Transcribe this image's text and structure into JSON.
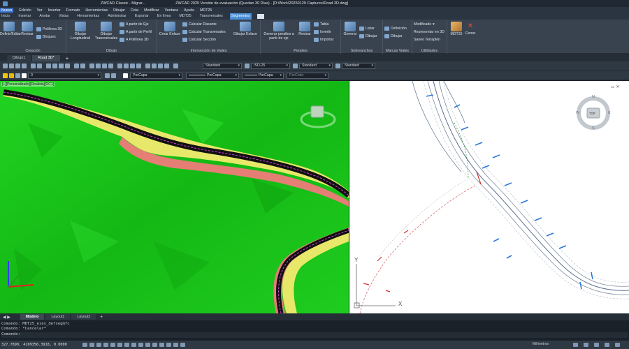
{
  "titlebar": {
    "quick_title": "ZWCAD Classic - Migrar...",
    "title": "ZWCAD 2025 Versión de evaluación (Quedan 30 Días) - [D:\\Work\\20250129 Captures\\Road 3D.dwg]"
  },
  "menu": [
    "Nuevo",
    "Edición",
    "Ver",
    "Insertar",
    "Formato",
    "Herramientas",
    "Dibujar",
    "Cota",
    "Modificar",
    "Ventana",
    "Ayuda",
    "MDT25"
  ],
  "ribbon_tabs": [
    "Inicio",
    "Insertar",
    "Anotar",
    "Vistas",
    "Herramientas",
    "Administrar",
    "Exportar",
    "En línea",
    "MDT25",
    "Transversales",
    "Segmentos"
  ],
  "ribbon_active_tab": "Segmentos",
  "ribbon": {
    "creacion": {
      "label": "Creación",
      "definir": "Definir/Editar",
      "revisar": "Revisar",
      "polilinea3d": "Polilínea 3D",
      "bloques": "Bloques"
    },
    "dibujo": {
      "label": "Dibujo",
      "longitudinal": "Dibujar Longitudinal",
      "transversales": "Dibujar Transversales",
      "apartir_eje": "A partir de Eje",
      "apartir_perfil": "A partir de Perfil",
      "apolilinea": "A Polilínea 3D"
    },
    "interseccion": {
      "label": "Intersección de Viales",
      "crear_enlace": "Crear Enlace",
      "calc_rasante": "Calcular Rasante",
      "calc_transversales": "Calcular Transversales",
      "calc_seccion": "Calcular Sección",
      "dibujar_enlace": "Dibujar Enlace"
    },
    "peraltes": {
      "label": "Peraltes",
      "generar": "Generar peraltes a partir de eje",
      "revisar": "Revisar",
      "tabla": "Tabla",
      "invertir": "Invertir",
      "importar": "Importar"
    },
    "sobreanchos": {
      "label": "Sobreanchos",
      "generar": "Generar",
      "listar": "Listar",
      "dibujar": "Dibujar"
    },
    "marcas": {
      "label": "Marcas Viales",
      "definicion": "Definición",
      "dibujar": "Dibujar"
    },
    "utilidades": {
      "label": "Utilidades",
      "modificado": "Modificado",
      "representar": "Representar en 3D",
      "saneo": "Saneo Terraplén"
    },
    "mdt25": "MDT25",
    "cerrar": "Cerrar"
  },
  "doc_tabs": [
    "Dibujo1",
    "Road 3D*"
  ],
  "doc_active": "Road 3D*",
  "toolbar": {
    "layer_value": "0",
    "textstyle": "Standard",
    "dimstyle": "ISO-25",
    "tablestyle": "Standard",
    "mlstyle": "Standard",
    "color": "PorCapa",
    "linetype": "PorCapa",
    "lineweight": "PorCapa",
    "plotstyle": "PorColor"
  },
  "viewport_left": {
    "label": "[+][Personalizado][Realista][OC1]"
  },
  "viewport_right": {
    "compass": {
      "n": "N",
      "s": "S",
      "e": "E",
      "w": "W",
      "top": "TOP"
    },
    "axis_x": "X",
    "axis_y": "Y"
  },
  "layout_tabs": [
    "Modelo",
    "Layout1",
    "Layout2"
  ],
  "layout_active": "Modelo",
  "command": {
    "line1": "Comando: MDT25_ejes_defsegmfc",
    "line2": "Comando: *Cancelar*",
    "prompt": "Comando:"
  },
  "status": {
    "coords": "327.7890, 4109356.3918, 0.0000",
    "units": "Milímetros"
  },
  "colors": {
    "terrain": "#17c417",
    "road": "#111111",
    "cut": "#f07a7a",
    "fill": "#f2ea6e",
    "accent": "#3f7ad8"
  }
}
